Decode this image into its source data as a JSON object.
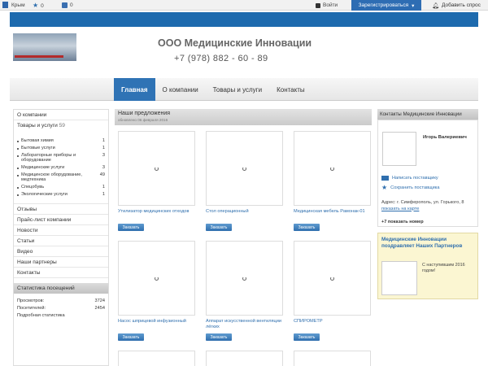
{
  "topbar": {
    "region": "Крым",
    "stars": "0",
    "compare": "0",
    "login": "Войти",
    "register": "Зарегистрироваться",
    "ask": "Добавить спрос"
  },
  "header": {
    "company": "ООО Медицинские Инновации",
    "phone": "+7 (978) 882 - 60 - 89"
  },
  "nav": {
    "tabs": [
      "Главная",
      "О компании",
      "Товары и услуги",
      "Контакты"
    ]
  },
  "left": {
    "about": "О компании",
    "goods_label": "Товары и услуги",
    "goods_count": "59",
    "categories": [
      {
        "name": "Бытовая химия",
        "count": "1"
      },
      {
        "name": "Бытовые услуги",
        "count": "1"
      },
      {
        "name": "Лабораторные приборы и оборудование",
        "count": "3"
      },
      {
        "name": "Медицинские услуги",
        "count": "3"
      },
      {
        "name": "Медицинское оборудование, медтехника",
        "count": "49"
      },
      {
        "name": "Спецобувь",
        "count": "1"
      },
      {
        "name": "Экологические услуги",
        "count": "1"
      }
    ],
    "links": [
      "Отзывы",
      "Прайс-лист компании",
      "Новости",
      "Статьи",
      "Видео",
      "Наши партнеры",
      "Контакты"
    ],
    "stats_title": "Статистика посещений",
    "views_label": "Просмотров:",
    "views_value": "3724",
    "visitors_label": "Посетителей:",
    "visitors_value": "2454",
    "detailed": "Подробная статистика"
  },
  "offers": {
    "title": "Наши предложения",
    "updated": "обновлено 06 февраля 2016",
    "order_label": "Заказать",
    "items": [
      {
        "name": "Утилизатор медицинских отходов"
      },
      {
        "name": "Стол операционный"
      },
      {
        "name": "Медицинская мебель Рамонак-01"
      },
      {
        "name": "Насос шприцевой инфузионный"
      },
      {
        "name": "Аппарат искусственной вентиляции лёгких"
      },
      {
        "name": "СПИРОМЕТР"
      }
    ]
  },
  "contacts": {
    "title": "Контакты Медицинские Инновации",
    "person": "Игорь Валериевич",
    "write": "Написать поставщику",
    "save": "Сохранить поставщика",
    "address_prefix": "Адрес: г. Симферополь, ул. Горького, 8",
    "map_link": "показать на карте",
    "show_phone": "+7 показать номер"
  },
  "promo": {
    "title": "Медицинские Инновации поздравляет Наших Партнеров",
    "text": "С наступившим 2016 годом!"
  },
  "colors": {
    "brand_blue": "#1d6aae",
    "link": "#2f6fae",
    "promo_bg": "#fbf6d2"
  }
}
